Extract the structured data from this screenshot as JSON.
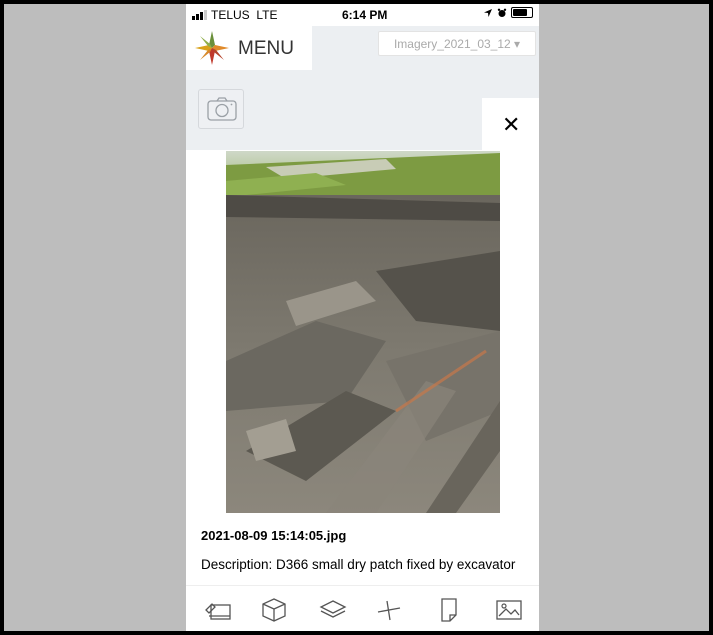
{
  "status_bar": {
    "carrier": "TELUS",
    "network": "LTE",
    "time": "6:14 PM"
  },
  "header": {
    "menu_label": "MENU",
    "imagery_select": "Imagery_2021_03_12 ▾"
  },
  "modal": {
    "close_label": "✕",
    "photo_title": "2021-08-09 15:14:05.jpg",
    "description": "Description: D366 small dry patch fixed by excavator"
  },
  "toolbar": {
    "items": [
      {
        "icon": "draw-icon"
      },
      {
        "icon": "cube-icon"
      },
      {
        "icon": "layers-icon"
      },
      {
        "icon": "measure-icon"
      },
      {
        "icon": "note-icon"
      },
      {
        "icon": "image-icon"
      }
    ]
  },
  "colors": {
    "header_bg": "#eceff2",
    "frame_bg": "#bdbdbd"
  }
}
